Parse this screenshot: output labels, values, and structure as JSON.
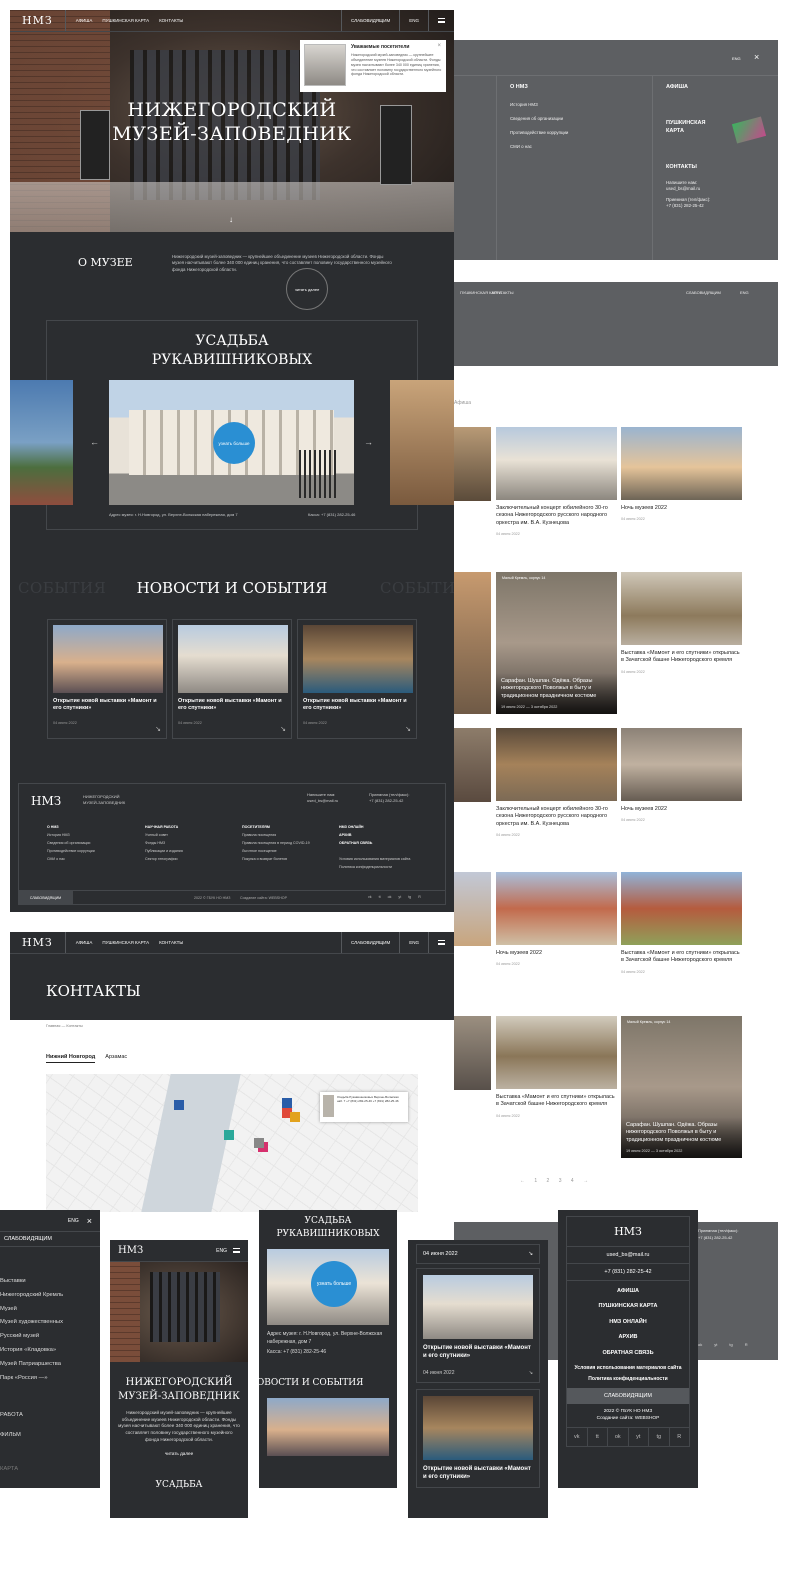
{
  "brand": {
    "logo": "НМЗ",
    "full_name": "НИЖЕГОРОДСКИЙ МУЗЕЙ-ЗАПОВЕДНИК",
    "footer_name_l1": "НИЖЕГОРОДСКИЙ",
    "footer_name_l2": "МУЗЕЙ-ЗАПОВЕДНИК"
  },
  "nav": {
    "items": [
      "АФИША",
      "ПУШКИНСКАЯ КАРТА",
      "КОНТАКТЫ"
    ],
    "accessibility": "СЛАБОВИДЯЩИМ",
    "lang": "ENG"
  },
  "hero": {
    "title_l1": "НИЖЕГОРОДСКИЙ",
    "title_l2": "МУЗЕЙ-ЗАПОВЕДНИК",
    "down_arrow": "↓"
  },
  "notice": {
    "title": "Уважаемые посетители",
    "body": "Нижегородский музей-заповедник — крупнейшее объединение музеев Нижегородской области. Фонды музея насчитывают более 340 000 единиц хранения, что составляет половину государственного музейного фонда Нижегородской области.",
    "close": "×"
  },
  "about": {
    "heading": "О МУЗЕЕ",
    "text": "Нижегородский музей-заповедник — крупнейшее объединение музеев Нижегородской области. Фонды музея насчитывают более 340 000 единиц хранения, что составляет половину государственного музейного фонда Нижегородской области.",
    "read_more": "читать далее"
  },
  "usadba": {
    "title_l1": "УСАДЬБА",
    "title_l2": "РУКАВИШНИКОВЫХ",
    "more": "узнать больше",
    "address": "Адрес музея: г. Н.Новгород, ул. Верхне-Волжская набережная, дом 7",
    "cash": "Касса: +7 (831) 282-25-46",
    "prev": "←",
    "next": "→"
  },
  "news": {
    "heading": "НОВОСТИ И СОБЫТИЯ",
    "ghost": "СОБЫТИЯ",
    "cards": [
      {
        "title": "Открытие новой выставки «Мамонт и его спутники»",
        "date": "04 июня 2022"
      },
      {
        "title": "Открытие новой выставки «Мамонт и его спутники»",
        "date": "04 июня 2022"
      },
      {
        "title": "Открытие новой выставки «Мамонт и его спутники»",
        "date": "04 июня 2022"
      }
    ]
  },
  "footer": {
    "email_label": "Напишите нам:",
    "email": "used_bs@mail.ru",
    "phone_label": "Приемная (тел/факс):",
    "phone": "+7 (831) 282-25-42",
    "col1": {
      "head": "О НМЗ",
      "items": [
        "История НМЗ",
        "Сведения об организации",
        "Противодействие коррупции",
        "СМИ о нас"
      ]
    },
    "col2": {
      "head": "НАУЧНАЯ РАБОТА",
      "items": [
        "Ученый совет",
        "Фонды НМЗ",
        "Публикации и издания",
        "Сектор этнографии"
      ]
    },
    "col3": {
      "head": "ПОСЕТИТЕЛЯМ",
      "items": [
        "Правила посещения",
        "Правила посещения в период COVID-19",
        "Льготное посещение",
        "Покупка и возврат билетов"
      ]
    },
    "col4": {
      "head": "НМЗ ОНЛАЙН",
      "items": [
        "АРХИВ",
        "ОБРАТНАЯ СВЯЗЬ"
      ],
      "legal1": "Условия использования материалов сайта",
      "legal2": "Политика конфиденциальности"
    },
    "copyright": "2022 © ГБУК НО НМЗ",
    "made_by": "Создание сайта: WEBSHOP",
    "social": [
      "vk",
      "tt",
      "ok",
      "yt",
      "tg",
      "R"
    ]
  },
  "contacts": {
    "title": "КОНТАКТЫ",
    "crumbs": "Главная — Контакты",
    "tabs": [
      "Нижний Новгород",
      "Арзамас"
    ],
    "popup": "Усадьба Рукавишниковых Верхне-Волжская наб. 7 +7 (831) 282-25-46 +7 (831) 282-25-46"
  },
  "menu": {
    "about_head": "О НМЗ",
    "about_items": [
      "История НМЗ",
      "Сведения об организации",
      "Противодействие коррупции",
      "СМИ о нас"
    ],
    "afisha": "АФИША",
    "pushkin_l1": "ПУШКИНСКАЯ",
    "pushkin_l2": "КАРТА",
    "contacts": "КОНТАКТЫ",
    "email_label": "Напишите нам:",
    "email": "used_bs@mail.ru",
    "phone_label": "Приемная (тел/факс):",
    "phone": "+7 (831) 282-25-42",
    "lang": "ENG",
    "close": "×"
  },
  "gallery": {
    "breadcrumb": "Афиша",
    "cards": [
      {
        "title": "Заключительный концерт юбилейного 30-го сезона Нижегородского русского народного оркестра им. В.А. Кузнецова",
        "date": "04 июня 2022"
      },
      {
        "title": "Ночь музеев 2022",
        "date": "04 июня 2022"
      },
      {
        "title": "Сарафан. Шушпан. Одёжа. Образы нижегородского Поволжья в быту и традиционном праздничном костюме",
        "date": "19 июля 2022 — 3 октября 2022",
        "tag": "Малый Кремль, корпус 14"
      },
      {
        "title": "Выставка «Мамонт и его спутники» открылась в Зачатской башне Нижегородского кремля",
        "date": "04 июня 2022"
      },
      {
        "title": "Заключительный концерт юбилейного 30-го сезона Нижегородского русского народного оркестра им. В.А. Кузнецова",
        "date": "04 июня 2022"
      },
      {
        "title": "Ночь музеев 2022",
        "date": "04 июня 2022"
      },
      {
        "title": "Ночь музеев 2022",
        "date": "04 июня 2022"
      },
      {
        "title": "Выставка «Мамонт и его спутники» открылась в Зачатской башне Нижегородского кремля",
        "date": "04 июня 2022"
      },
      {
        "title": "Выставка «Мамонт и его спутники» открылась в Зачатской башне Нижегородского кремля",
        "date": "04 июня 2022"
      },
      {
        "title": "Сарафан. Шушпан. Одёжа. Образы нижегородского Поволжья в быту и традиционном праздничном костюме",
        "date": "19 июля 2022 — 3 октября 2022",
        "tag": "Малый Кремль, корпус 14"
      }
    ],
    "pager": "← 1 2 3 4 →"
  },
  "mobile": {
    "menu_items": [
      "СЛАБОВИДЯЩИМ",
      "Выставки",
      "Нижегородский Кремль",
      "Музей",
      "Музей художественных",
      "Русский музей",
      "История «Кладовка»",
      "Музей Патриаршества",
      "Парк «Россия —»",
      "РАБОТА",
      "ФИЛЬМ",
      "КАРТА"
    ],
    "read_more": "читать далее",
    "date": "04 июня 2022",
    "foot_items": [
      "АФИША",
      "ПУШКИНСКАЯ КАРТА",
      "НМЗ ОНЛАЙН",
      "АРХИВ",
      "ОБРАТНАЯ СВЯЗЬ"
    ],
    "legal": "Условия использования материалов сайта",
    "privacy": "Политика конфиденциальности"
  }
}
